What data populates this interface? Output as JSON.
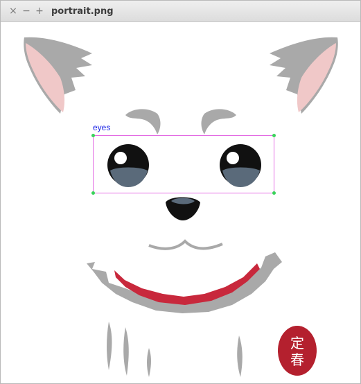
{
  "window": {
    "title": "portrait.png",
    "controls": {
      "close": "×",
      "minimize": "−",
      "maximize": "+"
    }
  },
  "annotation": {
    "label": "eyes",
    "box_color": "#e36be3",
    "handle_color": "#39d35a",
    "label_color": "#1a22e6"
  },
  "image": {
    "stamp_text": "定春",
    "colors": {
      "fur_gray": "#a9a9a9",
      "ear_pink": "#f0c8c8",
      "eye_blue": "#5a6a7a",
      "mouth_red": "#c8283c",
      "stamp_red": "#b4202e"
    }
  }
}
